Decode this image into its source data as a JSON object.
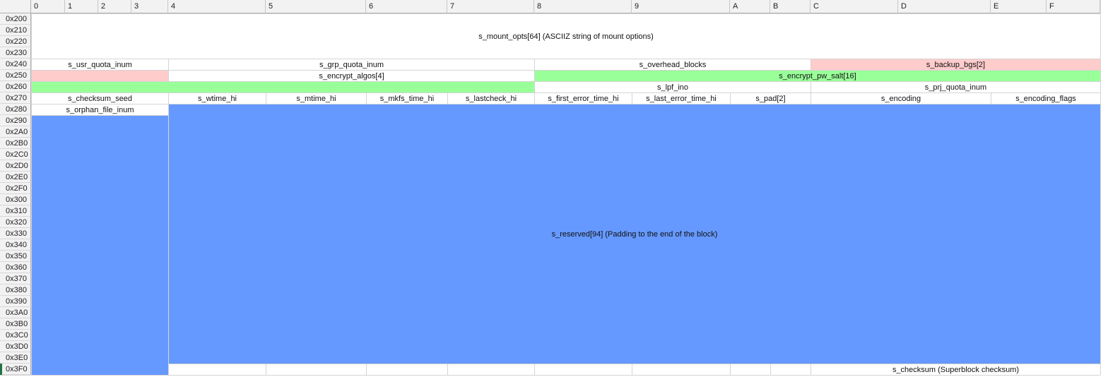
{
  "columns": [
    "0",
    "1",
    "2",
    "3",
    "4",
    "5",
    "6",
    "7",
    "8",
    "9",
    "A",
    "B",
    "C",
    "D",
    "E",
    "F"
  ],
  "rows": [
    "0x200",
    "0x210",
    "0x220",
    "0x230",
    "0x240",
    "0x250",
    "0x260",
    "0x270",
    "0x280",
    "0x290",
    "0x2A0",
    "0x2B0",
    "0x2C0",
    "0x2D0",
    "0x2E0",
    "0x2F0",
    "0x300",
    "0x310",
    "0x320",
    "0x330",
    "0x340",
    "0x350",
    "0x360",
    "0x370",
    "0x380",
    "0x390",
    "0x3A0",
    "0x3B0",
    "0x3C0",
    "0x3D0",
    "0x3E0",
    "0x3F0"
  ],
  "colors": {
    "pink": "#ffcccc",
    "green": "#99ff99",
    "blue": "#6699ff",
    "white": "#ffffff"
  },
  "fields": [
    {
      "name": "s_mount_opts[64] (ASCIIZ string of mount options)",
      "color": "white"
    },
    {
      "name": "s_usr_quota_inum",
      "color": "white"
    },
    {
      "name": "s_grp_quota_inum",
      "color": "white"
    },
    {
      "name": "s_overhead_blocks",
      "color": "white"
    },
    {
      "name": "s_backup_bgs[2]",
      "color": "pink"
    },
    {
      "name": "",
      "color": "pink"
    },
    {
      "name": "s_encrypt_algos[4]",
      "color": "white"
    },
    {
      "name": "s_encrypt_pw_salt[16]",
      "color": "green"
    },
    {
      "name": "",
      "color": "green"
    },
    {
      "name": "s_lpf_ino",
      "color": "white"
    },
    {
      "name": "s_prj_quota_inum",
      "color": "white"
    },
    {
      "name": "s_checksum_seed",
      "color": "white"
    },
    {
      "name": "s_wtime_hi",
      "color": "white"
    },
    {
      "name": "s_mtime_hi",
      "color": "white"
    },
    {
      "name": "s_mkfs_time_hi",
      "color": "white"
    },
    {
      "name": "s_lastcheck_hi",
      "color": "white"
    },
    {
      "name": "s_first_error_time_hi",
      "color": "white"
    },
    {
      "name": "s_last_error_time_hi",
      "color": "white"
    },
    {
      "name": "s_pad[2]",
      "color": "white"
    },
    {
      "name": "s_encoding",
      "color": "white"
    },
    {
      "name": "s_encoding_flags",
      "color": "white"
    },
    {
      "name": "s_orphan_file_inum",
      "color": "white"
    },
    {
      "name": "s_reserved[94] (Padding to the end of the block)",
      "color": "blue"
    },
    {
      "name": "",
      "color": "blue"
    },
    {
      "name": "s_checksum (Superblock checksum)",
      "color": "white"
    }
  ]
}
